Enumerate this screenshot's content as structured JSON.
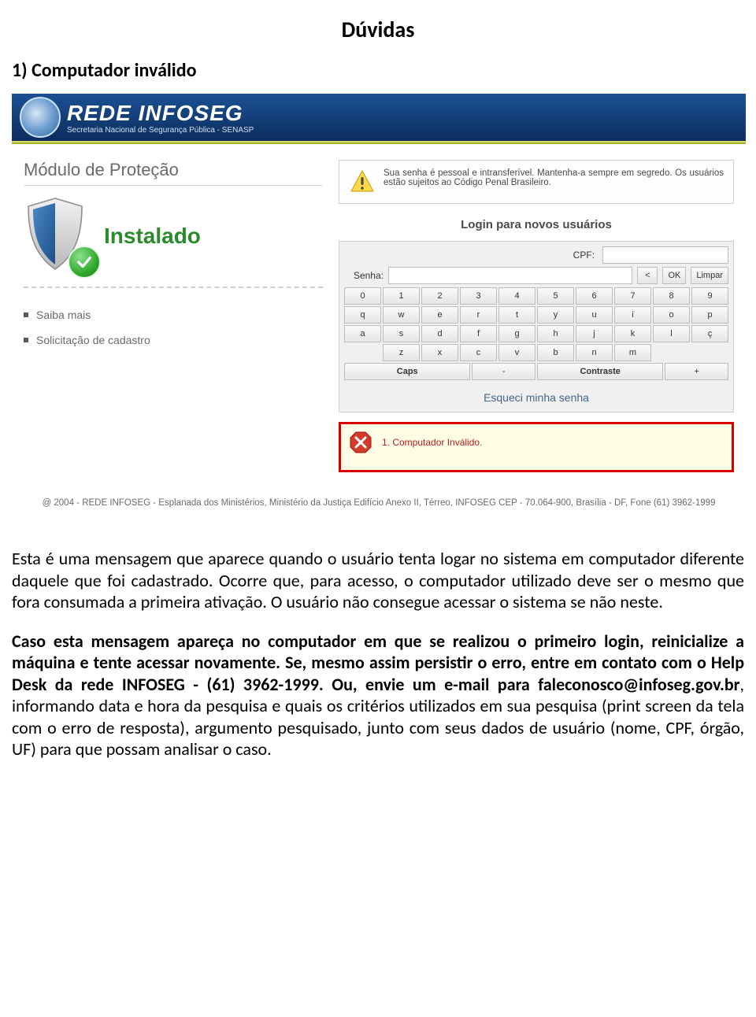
{
  "doc": {
    "title": "Dúvidas",
    "q1_heading": "1) Computador inválido",
    "para1": "Esta é uma mensagem que aparece quando o usuário tenta logar no sistema em computador diferente daquele que foi cadastrado. Ocorre que, para acesso, o computador utilizado deve ser o mesmo que fora consumada a primeira ativação. O usuário não consegue acessar o sistema se não neste.",
    "para2_bold": "Caso esta mensagem apareça no computador em que se realizou o primeiro login, reinicialize a máquina e tente acessar novamente. Se, mesmo assim persistir o erro, entre em contato com o Help Desk da rede INFOSEG -  (61) 3962-1999. Ou, envie um e-mail para faleconosco@infoseg.gov.br",
    "para2_rest": ", informando data e hora da pesquisa e quais os critérios utilizados em sua pesquisa (print screen da tela com o erro de resposta), argumento pesquisado, junto com seus dados de usuário (nome, CPF, órgão, UF) para que possam analisar o caso."
  },
  "screenshot": {
    "header": {
      "logo_main": "REDE INFOSEG",
      "logo_sub": "Secretaria Nacional de Segurança Pública - SENASP"
    },
    "left": {
      "module_title": "Módulo de Proteção",
      "installed": "Instalado",
      "links": [
        "Saiba mais",
        "Solicitação de cadastro"
      ]
    },
    "right": {
      "warning": "Sua senha é pessoal e intransferível. Mantenha-a sempre em segredo. Os usuários estão sujeitos ao Código Penal Brasileiro.",
      "login_title": "Login para novos usuários",
      "cpf_label": "CPF:",
      "senha_label": "Senha:",
      "btn_back": "<",
      "btn_ok": "OK",
      "btn_clear": "Limpar",
      "keys_row1": [
        "0",
        "1",
        "2",
        "3",
        "4",
        "5",
        "6",
        "7",
        "8",
        "9"
      ],
      "keys_row2": [
        "q",
        "w",
        "e",
        "r",
        "t",
        "y",
        "u",
        "i",
        "o",
        "p"
      ],
      "keys_row3": [
        "a",
        "s",
        "d",
        "f",
        "g",
        "h",
        "j",
        "k",
        "l",
        "ç"
      ],
      "keys_row4": [
        "z",
        "x",
        "c",
        "v",
        "b",
        "n",
        "m"
      ],
      "caps": "Caps",
      "minus": "-",
      "contrast": "Contraste",
      "plus": "+",
      "forgot": "Esqueci minha senha",
      "error": "1. Computador Inválido."
    },
    "footer": "@ 2004 - REDE INFOSEG - Esplanada dos Ministérios, Ministério da Justiça Edifício Anexo II, Térreo, INFOSEG CEP - 70.064-900, Brasília - DF, Fone (61) 3962-1999"
  }
}
